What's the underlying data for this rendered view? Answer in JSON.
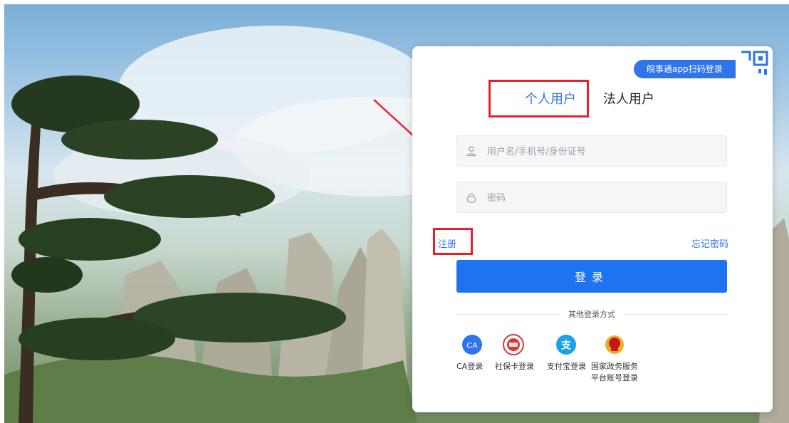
{
  "login": {
    "qr_badge": "皖事通app扫码登录",
    "tabs": [
      {
        "label": "个人用户",
        "active": true
      },
      {
        "label": "法人用户",
        "active": false
      }
    ],
    "username_placeholder": "用户名/手机号/身份证号",
    "password_placeholder": "密码",
    "register_label": "注册",
    "forgot_label": "忘记密码",
    "submit_label": "登录",
    "other_title": "其他登录方式",
    "methods": [
      {
        "label": "CA登录",
        "icon": "ca-icon",
        "color": "#2f74e8",
        "text": "CA"
      },
      {
        "label": "社保卡登录",
        "icon": "social-security-card-icon",
        "color": "#d33a3a"
      },
      {
        "label": "支付宝登录",
        "icon": "alipay-icon",
        "color": "#1aa1e8",
        "text": "支"
      },
      {
        "label_line1": "国家政务服务",
        "label_line2": "平台账号登录",
        "icon": "national-emblem-icon",
        "color": "#c8161d"
      }
    ]
  },
  "colors": {
    "accent": "#2f74e8",
    "annotation": "#e8202a"
  }
}
